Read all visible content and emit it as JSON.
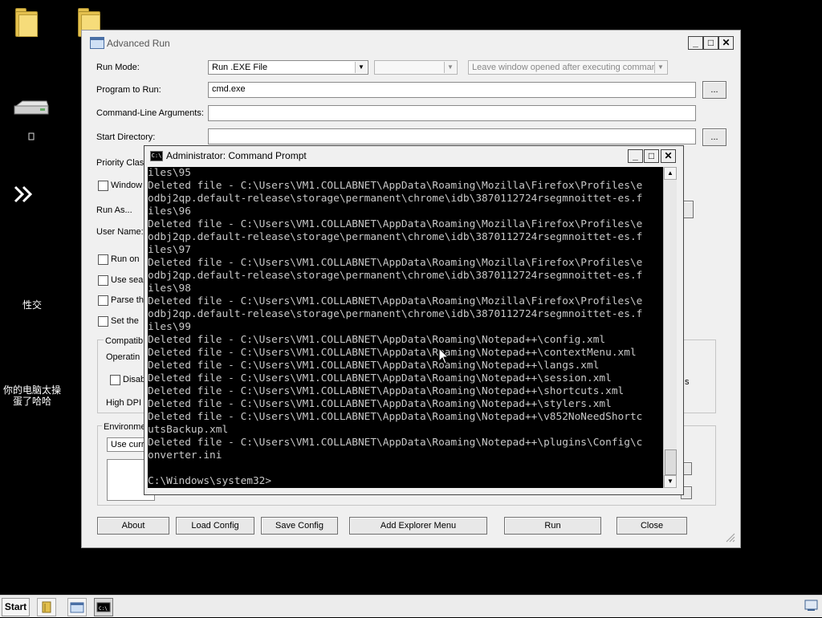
{
  "desktop": {
    "label_recycle": "性交",
    "label_network_line1": "你的电脑太操",
    "label_network_line2": "蛋了哈哈"
  },
  "advanced_run": {
    "title": "Advanced Run",
    "run_mode_label": "Run Mode:",
    "run_mode_value": "Run .EXE File",
    "leave_window_value": "Leave window opened after executing command",
    "program_label": "Program to Run:",
    "program_value": "cmd.exe",
    "args_label": "Command-Line Arguments:",
    "start_dir_label": "Start Directory:",
    "browse_label": "...",
    "priority_label": "Priority Clas",
    "window_label": "Window",
    "run_as_label": "Run As...",
    "user_name_label": "User Name:",
    "run_on_label": "Run on",
    "use_sea_label": "Use sea",
    "parse_label": "Parse th",
    "set_the_label": "Set the",
    "compat_label": "Compatib",
    "operating_label": "Operatin",
    "disab_label": "Disab",
    "highdpi_label": "High DPI",
    "environment_label": "Environme",
    "use_curr_value": "Use curr",
    "right_s_label": "s",
    "buttons": {
      "about": "About",
      "load_config": "Load Config",
      "save_config": "Save Config",
      "add_explorer_menu": "Add Explorer Menu",
      "run": "Run",
      "close": "Close"
    }
  },
  "cmd": {
    "title": "Administrator:  Command Prompt",
    "icon_text": "C:\\",
    "lines": [
      "iles\\95",
      "Deleted file - C:\\Users\\VM1.COLLABNET\\AppData\\Roaming\\Mozilla\\Firefox\\Profiles\\e",
      "odbj2qp.default-release\\storage\\permanent\\chrome\\idb\\3870112724rsegmnoittet-es.f",
      "iles\\96",
      "Deleted file - C:\\Users\\VM1.COLLABNET\\AppData\\Roaming\\Mozilla\\Firefox\\Profiles\\e",
      "odbj2qp.default-release\\storage\\permanent\\chrome\\idb\\3870112724rsegmnoittet-es.f",
      "iles\\97",
      "Deleted file - C:\\Users\\VM1.COLLABNET\\AppData\\Roaming\\Mozilla\\Firefox\\Profiles\\e",
      "odbj2qp.default-release\\storage\\permanent\\chrome\\idb\\3870112724rsegmnoittet-es.f",
      "iles\\98",
      "Deleted file - C:\\Users\\VM1.COLLABNET\\AppData\\Roaming\\Mozilla\\Firefox\\Profiles\\e",
      "odbj2qp.default-release\\storage\\permanent\\chrome\\idb\\3870112724rsegmnoittet-es.f",
      "iles\\99",
      "Deleted file - C:\\Users\\VM1.COLLABNET\\AppData\\Roaming\\Notepad++\\config.xml",
      "Deleted file - C:\\Users\\VM1.COLLABNET\\AppData\\Roaming\\Notepad++\\contextMenu.xml",
      "Deleted file - C:\\Users\\VM1.COLLABNET\\AppData\\Roaming\\Notepad++\\langs.xml",
      "Deleted file - C:\\Users\\VM1.COLLABNET\\AppData\\Roaming\\Notepad++\\session.xml",
      "Deleted file - C:\\Users\\VM1.COLLABNET\\AppData\\Roaming\\Notepad++\\shortcuts.xml",
      "Deleted file - C:\\Users\\VM1.COLLABNET\\AppData\\Roaming\\Notepad++\\stylers.xml",
      "Deleted file - C:\\Users\\VM1.COLLABNET\\AppData\\Roaming\\Notepad++\\v852NoNeedShortc",
      "utsBackup.xml",
      "Deleted file - C:\\Users\\VM1.COLLABNET\\AppData\\Roaming\\Notepad++\\plugins\\Config\\c",
      "onverter.ini",
      "",
      "C:\\Windows\\system32>"
    ]
  },
  "taskbar": {
    "start_label": "Start"
  }
}
